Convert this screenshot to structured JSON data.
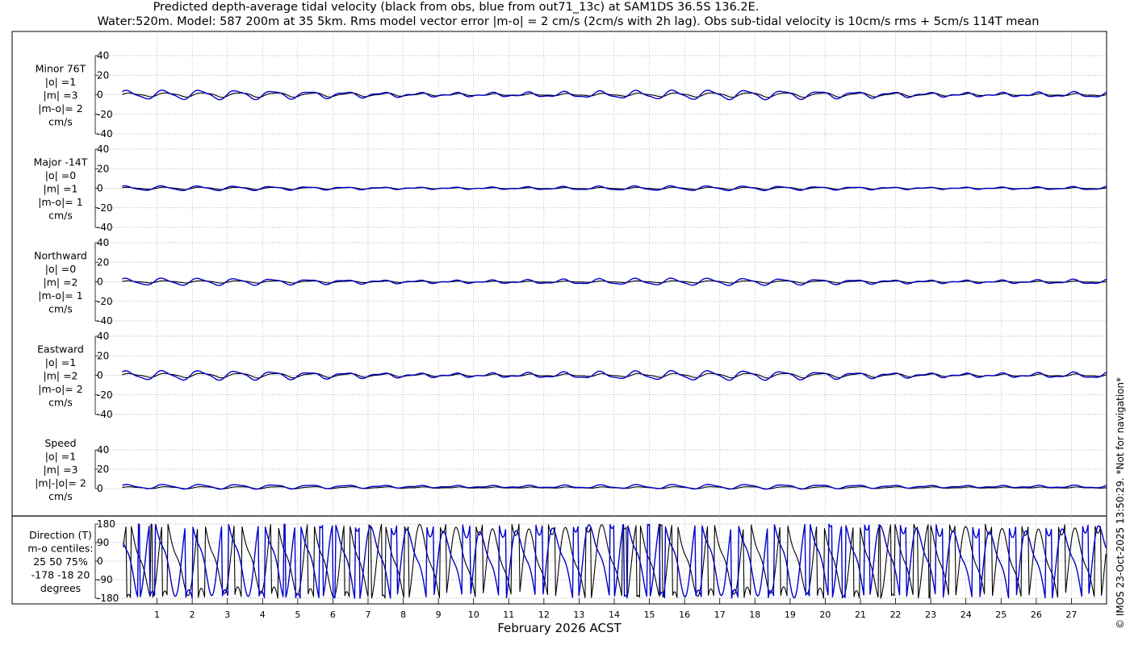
{
  "header": {
    "title_line1": "Predicted depth-average tidal velocity (black from obs, blue from out71_13c) at SAM1DS 36.5S 136.2E.",
    "title_line2": "Water:520m. Model: 587 200m at 35 5km. Rms model vector error |m-o| = 2 cm/s (2cm/s with 2h lag). Obs sub-tidal velocity is 10cm/s rms + 5cm/s 114T mean"
  },
  "footer": {
    "xlabel": "February 2026 ACST",
    "copyright": "© IMOS 23-Oct-2025 13:50:29. *Not for navigation*"
  },
  "colors": {
    "obs": "#000000",
    "model": "#0000cc",
    "grid": "#999999"
  },
  "chart_data": [
    {
      "type": "line",
      "panel": "minor",
      "labels": [
        "Minor 76T",
        "|o| =1",
        "|m| =3",
        "|m-o|= 2",
        "cm/s"
      ],
      "ylim": [
        -40,
        40
      ],
      "yticks": [
        "40",
        "20",
        "0",
        "-20",
        "-40"
      ],
      "xlim": [
        0,
        28
      ],
      "series": [
        {
          "role": "obs",
          "amplitude": 2,
          "phase": 0.0,
          "offset": 0
        },
        {
          "role": "model",
          "amplitude": 4,
          "phase": 0.6,
          "offset": 0
        }
      ]
    },
    {
      "type": "line",
      "panel": "major",
      "labels": [
        "Major -14T",
        "|o| =0",
        "|m| =1",
        "|m-o|= 1",
        "cm/s"
      ],
      "ylim": [
        -40,
        40
      ],
      "yticks": [
        "40",
        "20",
        "0",
        "-20",
        "-40"
      ],
      "xlim": [
        0,
        28
      ],
      "series": [
        {
          "role": "obs",
          "amplitude": 1,
          "phase": 0.3,
          "offset": 0
        },
        {
          "role": "model",
          "amplitude": 2,
          "phase": 0.9,
          "offset": 0
        }
      ]
    },
    {
      "type": "line",
      "panel": "northward",
      "labels": [
        "Northward",
        "|o| =0",
        "|m| =2",
        "|m-o|= 1",
        "cm/s"
      ],
      "ylim": [
        -40,
        40
      ],
      "yticks": [
        "40",
        "20",
        "0",
        "-20",
        "-40"
      ],
      "xlim": [
        0,
        28
      ],
      "series": [
        {
          "role": "obs",
          "amplitude": 1,
          "phase": 0.2,
          "offset": 0
        },
        {
          "role": "model",
          "amplitude": 3,
          "phase": 0.8,
          "offset": 0
        }
      ]
    },
    {
      "type": "line",
      "panel": "eastward",
      "labels": [
        "Eastward",
        "|o| =1",
        "|m| =2",
        "|m-o|= 2",
        "cm/s"
      ],
      "ylim": [
        -40,
        40
      ],
      "yticks": [
        "40",
        "20",
        "0",
        "-20",
        "-40"
      ],
      "xlim": [
        0,
        28
      ],
      "series": [
        {
          "role": "obs",
          "amplitude": 2,
          "phase": 0.1,
          "offset": 0
        },
        {
          "role": "model",
          "amplitude": 4,
          "phase": 0.7,
          "offset": 0
        }
      ]
    },
    {
      "type": "line",
      "panel": "speed",
      "labels": [
        "Speed",
        "|o| =1",
        "|m| =3",
        "|m|-|o|= 2",
        "cm/s"
      ],
      "ylim": [
        0,
        40
      ],
      "yticks": [
        "40",
        "20",
        "0"
      ],
      "xlim": [
        0,
        28
      ],
      "series": [
        {
          "role": "obs",
          "amplitude": 1,
          "phase": 0.0,
          "offset": 1
        },
        {
          "role": "model",
          "amplitude": 2,
          "phase": 0.5,
          "offset": 2
        }
      ]
    },
    {
      "type": "line",
      "panel": "direction",
      "labels": [
        "Direction (T)",
        "m-o centiles:",
        "25  50  75%",
        "-178  -18   20",
        "degrees"
      ],
      "ylim": [
        -180,
        180
      ],
      "yticks": [
        "180",
        "90",
        "0",
        "-90",
        "-180"
      ],
      "xlim": [
        0,
        28
      ],
      "series": [
        {
          "role": "obs",
          "kind": "direction",
          "phase": 0.0
        },
        {
          "role": "model",
          "kind": "direction",
          "phase": 0.35
        }
      ]
    }
  ],
  "x_axis": {
    "ticks": [
      "1",
      "2",
      "3",
      "4",
      "5",
      "6",
      "7",
      "8",
      "9",
      "10",
      "11",
      "12",
      "13",
      "14",
      "15",
      "16",
      "17",
      "18",
      "19",
      "20",
      "21",
      "22",
      "23",
      "24",
      "25",
      "26",
      "27"
    ]
  }
}
